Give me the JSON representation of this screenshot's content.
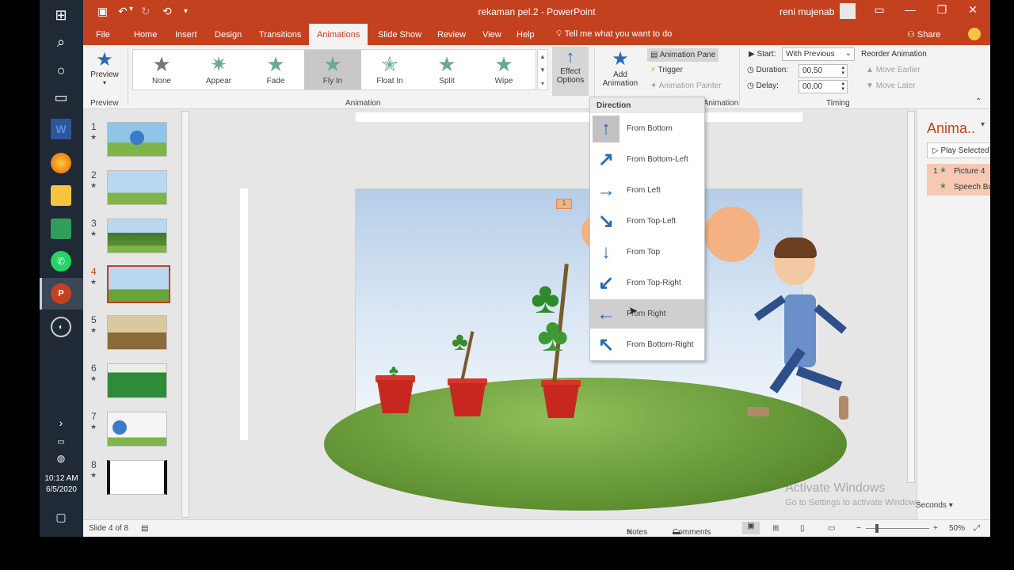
{
  "window": {
    "title": "rekaman pel.2  -  PowerPoint",
    "user": "reni mujenab"
  },
  "taskbar": {
    "icons": [
      "windows-icon",
      "search-icon",
      "cortana-icon",
      "task-view-icon",
      "word-icon",
      "firefox-icon",
      "file-explorer-icon",
      "sheets-icon",
      "whatsapp-icon",
      "powerpoint-icon",
      "obs-icon"
    ],
    "time": "10:12 AM",
    "date": "6/5/2020"
  },
  "tabs": [
    "File",
    "Home",
    "Insert",
    "Design",
    "Transitions",
    "Animations",
    "Slide Show",
    "Review",
    "View",
    "Help"
  ],
  "active_tab": "Animations",
  "tell_me": "Tell me what you want to do",
  "share": "Share",
  "ribbon": {
    "preview": {
      "label": "Preview",
      "group": "Preview"
    },
    "gallery": [
      {
        "label": "None"
      },
      {
        "label": "Appear"
      },
      {
        "label": "Fade"
      },
      {
        "label": "Fly In"
      },
      {
        "label": "Float In"
      },
      {
        "label": "Split"
      },
      {
        "label": "Wipe"
      }
    ],
    "gallery_group": "Animation",
    "effect_options": {
      "line1": "Effect",
      "line2": "Options"
    },
    "add_animation": {
      "line1": "Add",
      "line2": "Animation"
    },
    "animation_pane": "Animation Pane",
    "trigger": "Trigger",
    "animation_painter": "Animation Painter",
    "advanced_group": "Advanced Animation",
    "start_label": "Start:",
    "start_value": "With Previous",
    "duration_label": "Duration:",
    "duration_value": "00.50",
    "delay_label": "Delay:",
    "delay_value": "00.00",
    "reorder": "Reorder Animation",
    "move_earlier": "Move Earlier",
    "move_later": "Move Later",
    "timing_group": "Timing"
  },
  "thumbnails": [
    {
      "num": "1",
      "star": "★"
    },
    {
      "num": "2",
      "star": "★"
    },
    {
      "num": "3",
      "star": "★"
    },
    {
      "num": "4",
      "star": "★"
    },
    {
      "num": "5",
      "star": "★"
    },
    {
      "num": "6",
      "star": "★"
    },
    {
      "num": "7",
      "star": "★"
    },
    {
      "num": "8",
      "star": "★"
    }
  ],
  "selected_slide_index": 4,
  "slide": {
    "anim_marker": "1"
  },
  "direction_menu": {
    "heading": "Direction",
    "items": [
      {
        "label": "From Bottom",
        "icon": "arrow-up-icon",
        "glyph": "↑"
      },
      {
        "label": "From Bottom-Left",
        "icon": "arrow-up-right-icon",
        "glyph": "↗"
      },
      {
        "label": "From Left",
        "icon": "arrow-right-icon",
        "glyph": "→"
      },
      {
        "label": "From Top-Left",
        "icon": "arrow-down-right-icon",
        "glyph": "↘"
      },
      {
        "label": "From Top",
        "icon": "arrow-down-icon",
        "glyph": "↓"
      },
      {
        "label": "From Top-Right",
        "icon": "arrow-down-left-icon",
        "glyph": "↙"
      },
      {
        "label": "From Right",
        "icon": "arrow-left-icon",
        "glyph": "←"
      },
      {
        "label": "From Bottom-Right",
        "icon": "arrow-up-left-icon",
        "glyph": "↖"
      }
    ],
    "selected": "From Bottom",
    "hovered": "From Right"
  },
  "animation_pane": {
    "title": "Anima..",
    "play_selected": "Play Selected",
    "items": [
      {
        "num": "1",
        "label": "Picture 4"
      },
      {
        "num": "",
        "label": "Speech Bubbl..."
      }
    ],
    "seconds": "Seconds"
  },
  "status": {
    "slide_info": "Slide 4 of 8",
    "notes": "Notes",
    "comments": "Comments",
    "zoom": "50%"
  },
  "watermark": {
    "line1": "Activate Windows",
    "line2": "Go to Settings to activate Windows."
  },
  "colors": {
    "accent": "#c4411f",
    "arrow_blue": "#2b6cb3",
    "star_teal": "#6aa89a"
  }
}
